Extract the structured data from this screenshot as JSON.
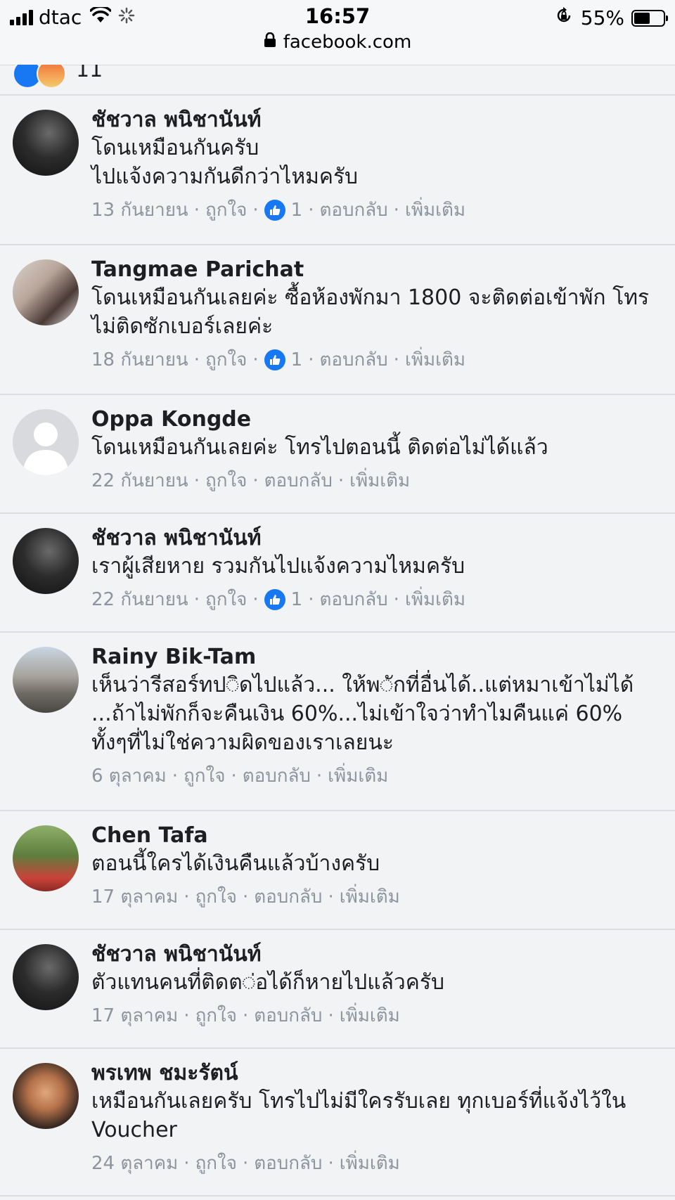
{
  "status_bar": {
    "carrier": "dtac",
    "time": "16:57",
    "battery": "55%",
    "battery_level": 0.55,
    "url": "facebook.com"
  },
  "reactions_summary": {
    "count": "11"
  },
  "comments": [
    {
      "author": "ชัชวาล พนิชานันท์",
      "avatar": "dark-silhouette",
      "lines": [
        "โดนเหมือนกันครับ",
        "ไปแจ้งความกันดีกว่าไหมครับ"
      ],
      "date": "13 กันยายน",
      "like_label": "ถูกใจ",
      "likes": "1",
      "reply_label": "ตอบกลับ",
      "more_label": "เพิ่มเติม"
    },
    {
      "author": "Tangmae Parichat",
      "avatar": "couple-photo",
      "lines": [
        "โดนเหมือนกันเลยค่ะ ซื้อห้องพักมา 1800 จะติดต่อเข้าพัก โทร",
        "ไม่ติดซักเบอร์เลยค่ะ"
      ],
      "date": "18 กันยายน",
      "like_label": "ถูกใจ",
      "likes": "1",
      "reply_label": "ตอบกลับ",
      "more_label": "เพิ่มเติม"
    },
    {
      "author": "Oppa Kongde",
      "avatar": "default-profile",
      "lines": [
        "โดนเหมือนกันเลยค่ะ โทรไปตอนนี้ ติดต่อไม่ได้แล้ว"
      ],
      "date": "22 กันยายน",
      "like_label": "ถูกใจ",
      "likes": null,
      "reply_label": "ตอบกลับ",
      "more_label": "เพิ่มเติม"
    },
    {
      "author": "ชัชวาล พนิชานันท์",
      "avatar": "dark-silhouette",
      "lines": [
        "เราผู้เสียหาย รวมกันไปแจ้งความไหมครับ"
      ],
      "date": "22 กันยายน",
      "like_label": "ถูกใจ",
      "likes": "1",
      "reply_label": "ตอบกลับ",
      "more_label": "เพิ่มเติม"
    },
    {
      "author": "Rainy Bik-Tam",
      "avatar": "louvre-photo",
      "lines": [
        "เห็นว่ารีสอร์ทป◌ิดไปแล้ว... ให้พ◌ักที่อื่นได้..แต่หมาเข้าไม่ได้",
        "...ถ้าไม่พักก็จะคืนเงิน 60%...ไม่เข้าใจว่าทำไมคืนแค่ 60%",
        "ทั้งๆที่ไม่ใช่ความผิดของเราเลยนะ"
      ],
      "date": "6 ตุลาคม",
      "like_label": "ถูกใจ",
      "likes": null,
      "reply_label": "ตอบกลับ",
      "more_label": "เพิ่มเติม"
    },
    {
      "author": "Chen Tafa",
      "avatar": "garden-photo",
      "lines": [
        "ตอนนี้ใครได้เงินคืนแล้วบ้างครับ"
      ],
      "date": "17 ตุลาคม",
      "like_label": "ถูกใจ",
      "likes": null,
      "reply_label": "ตอบกลับ",
      "more_label": "เพิ่มเติม"
    },
    {
      "author": "ชัชวาล พนิชานันท์",
      "avatar": "dark-silhouette",
      "lines": [
        "ตัวแทนคนที่ติดต◌่อได้ก็หายไปแล้วครับ"
      ],
      "date": "17 ตุลาคม",
      "like_label": "ถูกใจ",
      "likes": null,
      "reply_label": "ตอบกลับ",
      "more_label": "เพิ่มเติม"
    },
    {
      "author": "พรเทพ ชมะรัตน์",
      "avatar": "man-portrait",
      "lines": [
        "เหมือนกันเลยครับ โทรไปไม่มีใครรับเลย ทุกเบอร์ที่แจ้งไว้ใน",
        "Voucher"
      ],
      "date": "24 ตุลาคม",
      "like_label": "ถูกใจ",
      "likes": null,
      "reply_label": "ตอบกลับ",
      "more_label": "เพิ่มเติม"
    }
  ],
  "colors": {
    "background": "#f2f3f5",
    "meta_text": "#8d949e",
    "like_blue": "#1877f2",
    "divider": "#dadde1"
  }
}
